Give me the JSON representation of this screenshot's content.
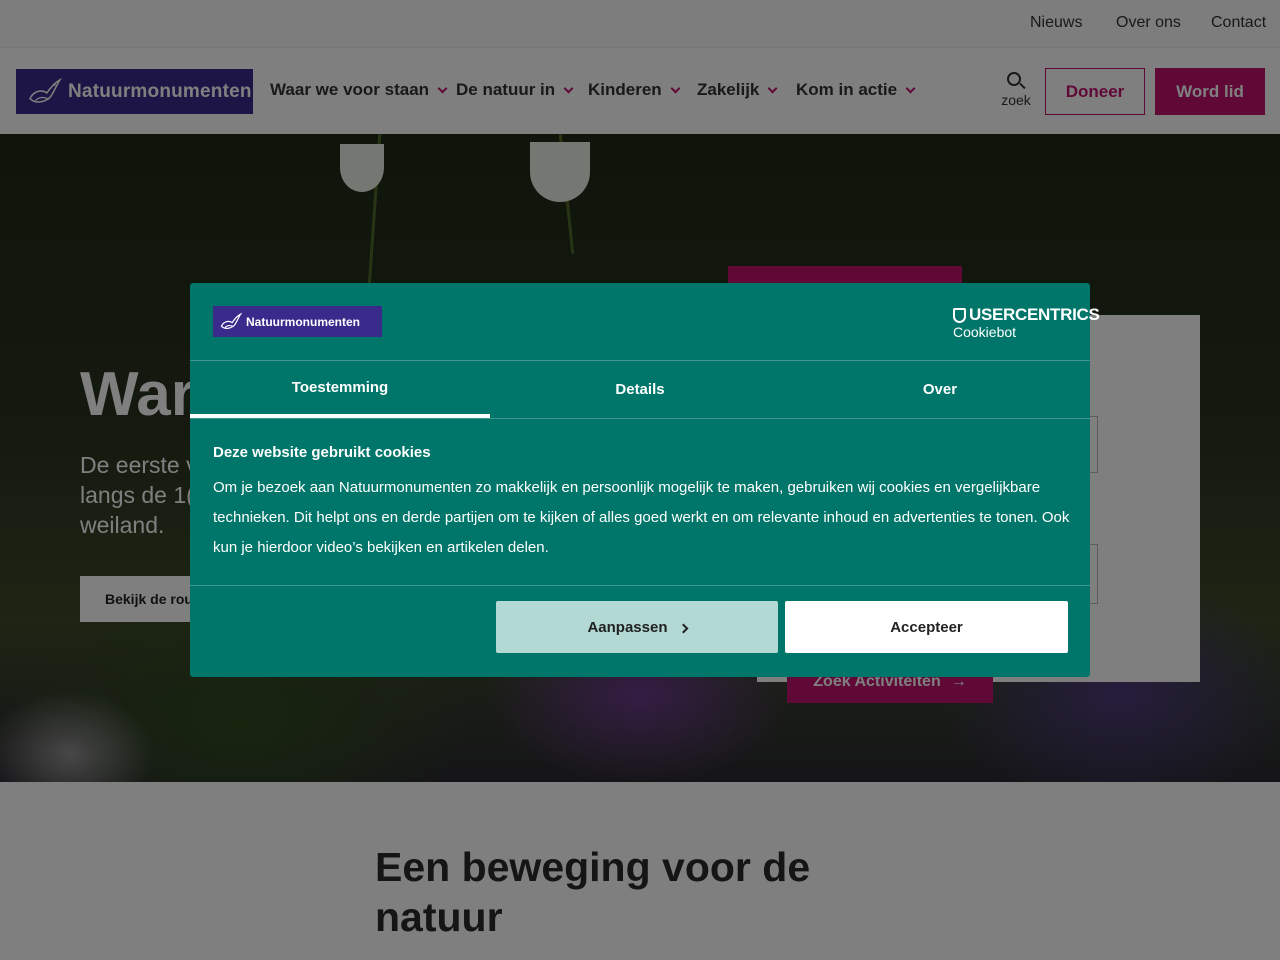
{
  "topbar": {
    "links": [
      "Nieuws",
      "Over ons",
      "Contact"
    ]
  },
  "header": {
    "logo_text": "Natuurmonumenten",
    "nav": [
      "Waar we voor staan",
      "De natuur in",
      "Kinderen",
      "Zakelijk",
      "Kom in actie"
    ],
    "search_label": "zoek",
    "donate_label": "Doneer",
    "join_label": "Word lid"
  },
  "hero": {
    "title": "War",
    "subtitle": "De eerste v langs de 1( weiland.",
    "button_label": "Bekijk de rou",
    "search_button_label": "Zoek Activiteiten"
  },
  "section": {
    "heading": "Een beweging voor de natuur"
  },
  "cookie_dialog": {
    "logo_text": "Natuurmonumenten",
    "provider_top": "USERCENTRICS",
    "provider_bottom": "Cookiebot",
    "tabs": [
      "Toestemming",
      "Details",
      "Over"
    ],
    "active_tab": "Toestemming",
    "heading": "Deze website gebruikt cookies",
    "body": "Om je bezoek aan Natuurmonumenten zo makkelijk en persoonlijk mogelijk te maken, gebruiken wij cookies en vergelijkbare technieken. Dit helpt ons en derde partijen om te kijken of alles goed werkt en om relevante inhoud en advertenties te tonen. Ook kun je hierdoor video’s bekijken en artikelen delen.",
    "adjust_label": "Aanpassen",
    "accept_label": "Accepteer"
  },
  "colors": {
    "brand_purple": "#3a2a8c",
    "accent_magenta": "#c0136e",
    "dialog_green": "#00766a",
    "adjust_button": "#b2d9d3"
  }
}
